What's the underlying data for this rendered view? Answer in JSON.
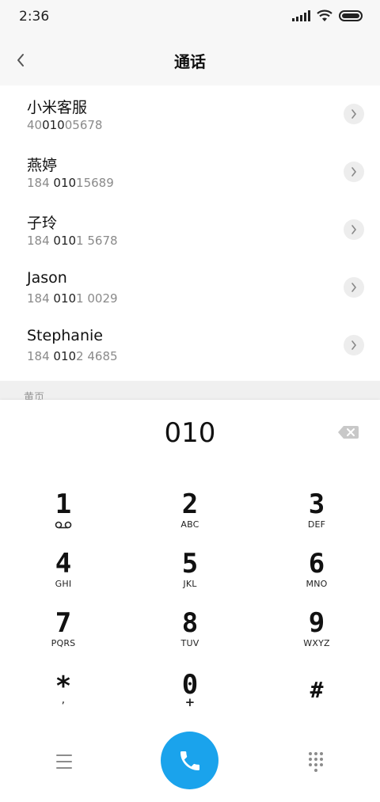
{
  "status_bar": {
    "time": "2:36"
  },
  "header": {
    "title": "通话"
  },
  "contacts": [
    {
      "name": "小米客服",
      "number_pre": "40",
      "number_match": "010",
      "number_post": "05678"
    },
    {
      "name": "燕婷",
      "number_pre": "184 ",
      "number_match": "010",
      "number_post": "15689"
    },
    {
      "name": "子玲",
      "number_pre": "184 ",
      "number_match": "010",
      "number_post": "1 5678"
    },
    {
      "name": "Jason",
      "number_pre": "184 ",
      "number_match": "010",
      "number_post": "1 0029"
    },
    {
      "name": "Stephanie",
      "number_pre": "184 ",
      "number_match": "010",
      "number_post": "2 4685"
    }
  ],
  "section": {
    "label": "黄页"
  },
  "dialer": {
    "input": "010",
    "keys": [
      {
        "digit": "1",
        "letters": ""
      },
      {
        "digit": "2",
        "letters": "ABC"
      },
      {
        "digit": "3",
        "letters": "DEF"
      },
      {
        "digit": "4",
        "letters": "GHI"
      },
      {
        "digit": "5",
        "letters": "JKL"
      },
      {
        "digit": "6",
        "letters": "MNO"
      },
      {
        "digit": "7",
        "letters": "PQRS"
      },
      {
        "digit": "8",
        "letters": "TUV"
      },
      {
        "digit": "9",
        "letters": "WXYZ"
      },
      {
        "digit": "*",
        "letters": ","
      },
      {
        "digit": "0",
        "letters": "+"
      },
      {
        "digit": "#",
        "letters": ""
      }
    ]
  },
  "colors": {
    "accent": "#1aa3ec",
    "background": "#ffffff",
    "header_bg": "#f7f7f7"
  },
  "icons": {
    "back": "chevron-left-icon",
    "detail": "chevron-right-icon",
    "delete": "backspace-icon",
    "menu": "menu-icon",
    "call": "phone-icon",
    "keypad": "dialpad-icon"
  }
}
